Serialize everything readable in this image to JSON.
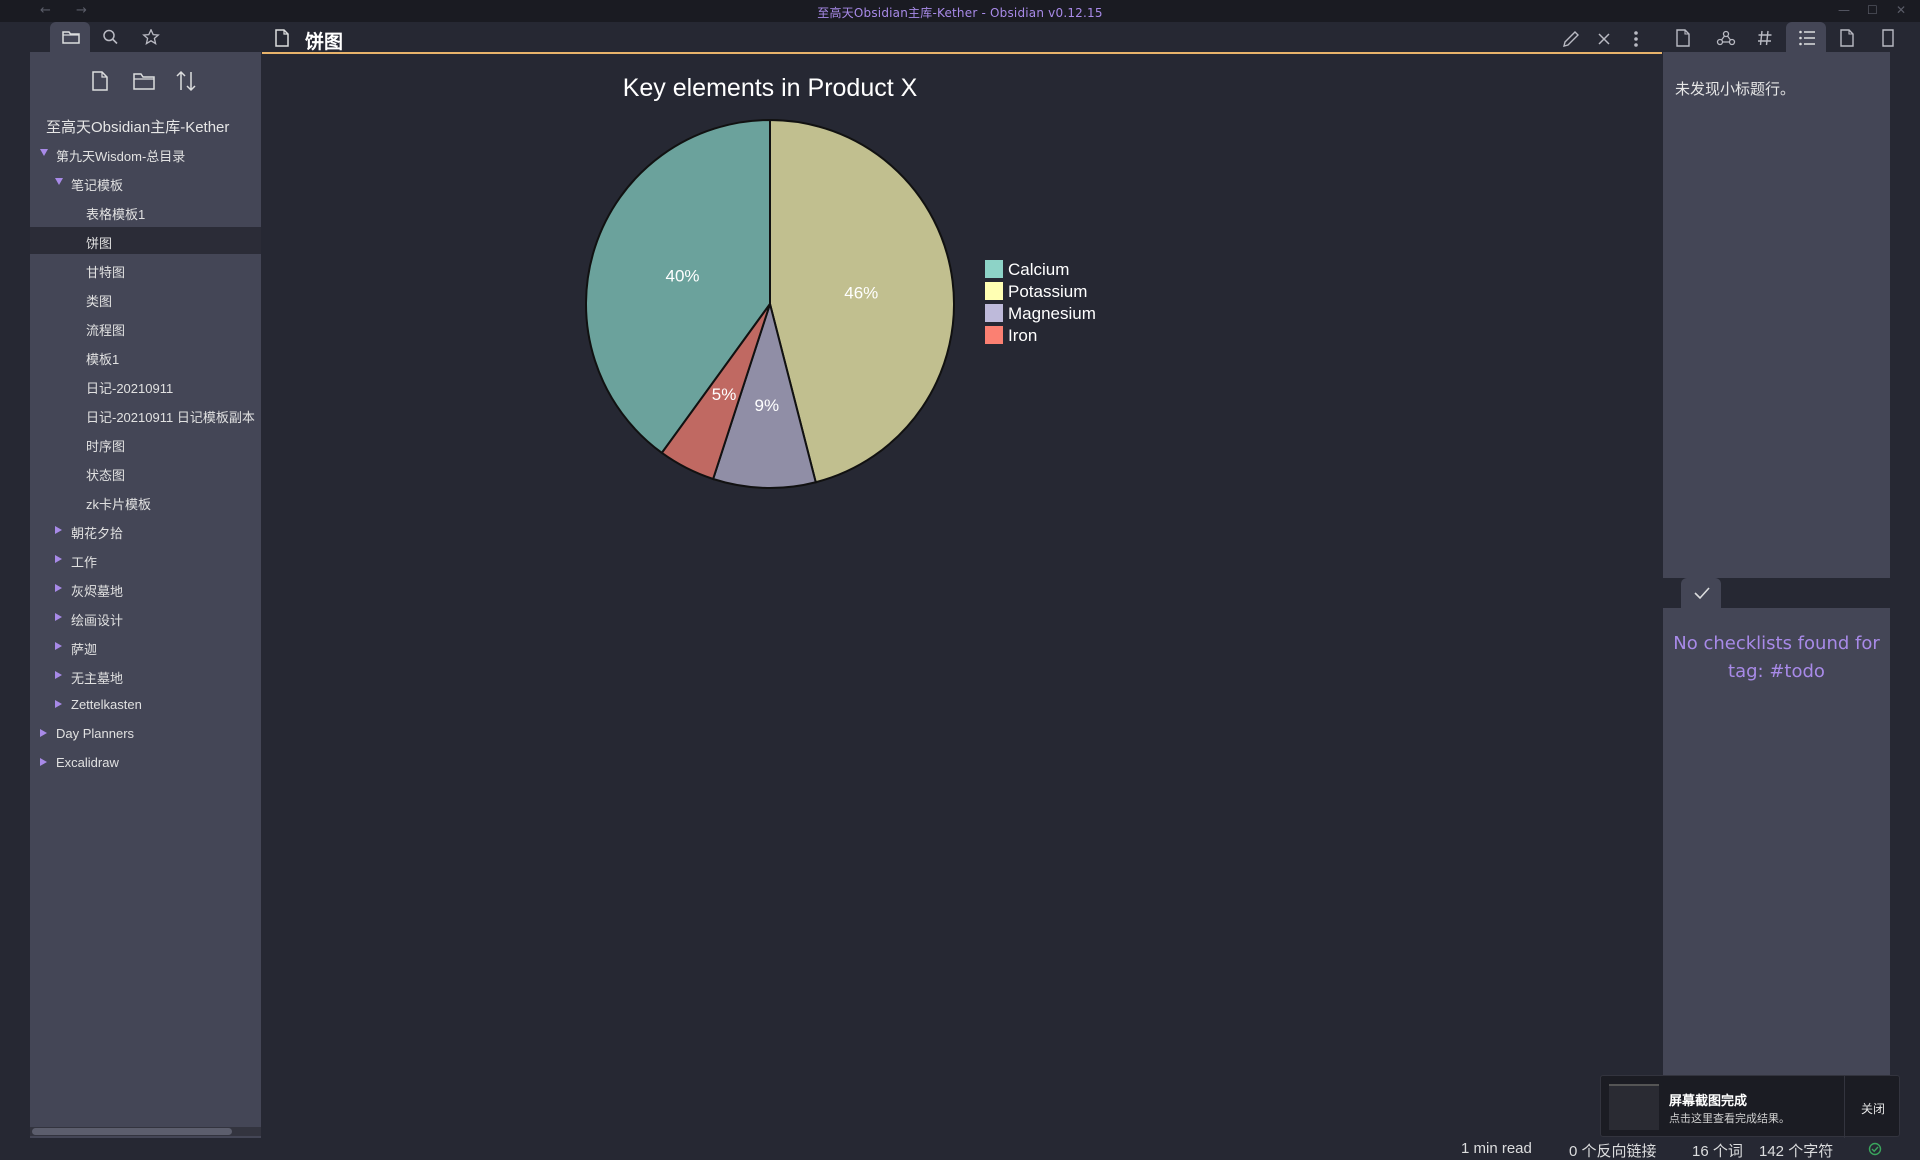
{
  "window": {
    "title": "至高天Obsidian主库-Kether - Obsidian v0.12.15",
    "back_glyph": "←",
    "forward_glyph": "→",
    "minimize_glyph": "—",
    "maximize_glyph": "☐",
    "close_glyph": "✕"
  },
  "left_sidebar": {
    "tabs": [
      {
        "icon": "folder-icon",
        "active": true
      },
      {
        "icon": "search-icon",
        "active": false
      },
      {
        "icon": "star-icon",
        "active": false
      }
    ],
    "actions": [
      "new-note-icon",
      "new-folder-icon",
      "sort-icon"
    ],
    "vault_name": "至高天Obsidian主库-Kether",
    "tree": [
      {
        "label": "第九天Wisdom-总目录",
        "level": 0,
        "state": "open"
      },
      {
        "label": "笔记模板",
        "level": 1,
        "state": "open"
      },
      {
        "label": "表格模板1",
        "level": 2,
        "state": "file"
      },
      {
        "label": "饼图",
        "level": 2,
        "state": "file",
        "active": true
      },
      {
        "label": "甘特图",
        "level": 2,
        "state": "file"
      },
      {
        "label": "类图",
        "level": 2,
        "state": "file"
      },
      {
        "label": "流程图",
        "level": 2,
        "state": "file"
      },
      {
        "label": "模板1",
        "level": 2,
        "state": "file"
      },
      {
        "label": "日记-20210911",
        "level": 2,
        "state": "file"
      },
      {
        "label": "日记-20210911 日记模板副本",
        "level": 2,
        "state": "file"
      },
      {
        "label": "时序图",
        "level": 2,
        "state": "file"
      },
      {
        "label": "状态图",
        "level": 2,
        "state": "file"
      },
      {
        "label": "zk卡片模板",
        "level": 2,
        "state": "file"
      },
      {
        "label": "朝花夕拾",
        "level": 1,
        "state": "closed"
      },
      {
        "label": "工作",
        "level": 1,
        "state": "closed"
      },
      {
        "label": "灰烬墓地",
        "level": 1,
        "state": "closed"
      },
      {
        "label": "绘画设计",
        "level": 1,
        "state": "closed"
      },
      {
        "label": "萨迦",
        "level": 1,
        "state": "closed"
      },
      {
        "label": "无主墓地",
        "level": 1,
        "state": "closed"
      },
      {
        "label": "Zettelkasten",
        "level": 1,
        "state": "closed"
      },
      {
        "label": "Day Planners",
        "level": 0,
        "state": "closed"
      },
      {
        "label": "Excalidraw",
        "level": 0,
        "state": "closed"
      }
    ]
  },
  "editor": {
    "note_title": "饼图",
    "actions": [
      "edit-icon",
      "close-icon",
      "more-options-icon"
    ]
  },
  "chart_data": {
    "type": "pie",
    "title": "Key elements in Product X",
    "categories": [
      "Calcium",
      "Potassium",
      "Magnesium",
      "Iron"
    ],
    "values": [
      40,
      46,
      9,
      5
    ],
    "labels": [
      "40%",
      "46%",
      "9%",
      "5%"
    ],
    "legend_colors": [
      "#8dd3c7",
      "#ffffb3",
      "#bebada",
      "#fb8072"
    ],
    "slice_colors": [
      "#6ba29c",
      "#c1bf8f",
      "#908ea6",
      "#c06962"
    ],
    "legend_position": "right"
  },
  "right_sidebar": {
    "tabs": [
      {
        "icon": "file-icon",
        "active": false
      },
      {
        "icon": "graph-icon",
        "active": false
      },
      {
        "icon": "tag-icon",
        "active": false
      },
      {
        "icon": "outline-icon",
        "active": true
      },
      {
        "icon": "file-icon",
        "active": false
      },
      {
        "icon": "bookmark-icon",
        "active": false
      }
    ],
    "outline_empty": "未发现小标题行。",
    "checklist_tab_icon": "checkmark-icon",
    "checklist_empty": "No checklists found for tag: #todo"
  },
  "notification": {
    "title": "屏幕截图完成",
    "subtitle": "点击这里查看完成结果。",
    "close_label": "关闭"
  },
  "status_bar": {
    "read_time": "1 min read",
    "backlinks": "0 个反向链接",
    "words": "16 个词",
    "chars": "142 个字符",
    "sync_icon": "sync-check-icon"
  }
}
